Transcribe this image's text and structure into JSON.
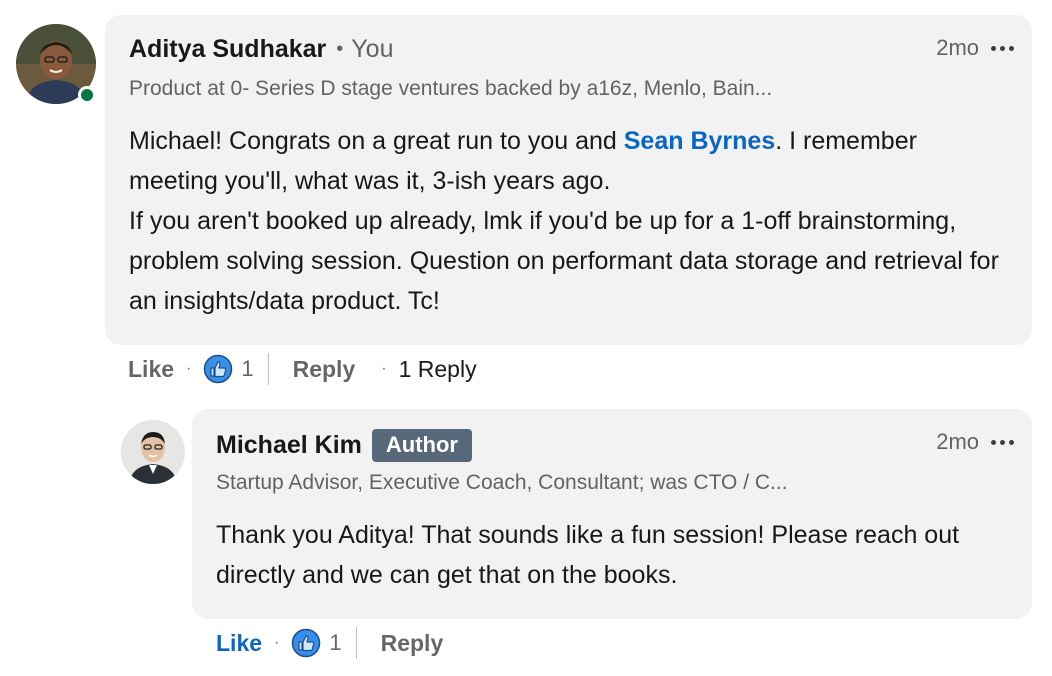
{
  "colors": {
    "accent": "#0a66c2",
    "presence": "#057642",
    "bubble": "#f2f2f2",
    "badge": "#56687a"
  },
  "comment": {
    "author": "Aditya Sudhakar",
    "relation": "You",
    "time": "2mo",
    "headline": "Product at 0- Series D stage ventures backed by a16z, Menlo, Bain...",
    "text_before": "Michael! Congrats on a great run to you and ",
    "mention": "Sean Byrnes",
    "text_after": ". I remember meeting you'll, what was it, 3-ish years ago.",
    "text_para2": "If you aren't booked up already, lmk if you'd be up for a 1-off brainstorming, problem solving session. Question on performant data storage and retrieval for an insights/data product. Tc!",
    "actions": {
      "like": "Like",
      "like_count": "1",
      "reply": "Reply",
      "replies": "1 Reply"
    }
  },
  "reply": {
    "author": "Michael Kim",
    "badge": "Author",
    "time": "2mo",
    "headline": "Startup Advisor, Executive Coach, Consultant; was CTO / C...",
    "text": "Thank you Aditya! That sounds like a fun session! Please reach out directly and we can get that on the books.",
    "actions": {
      "like": "Like",
      "like_count": "1",
      "reply": "Reply"
    }
  }
}
